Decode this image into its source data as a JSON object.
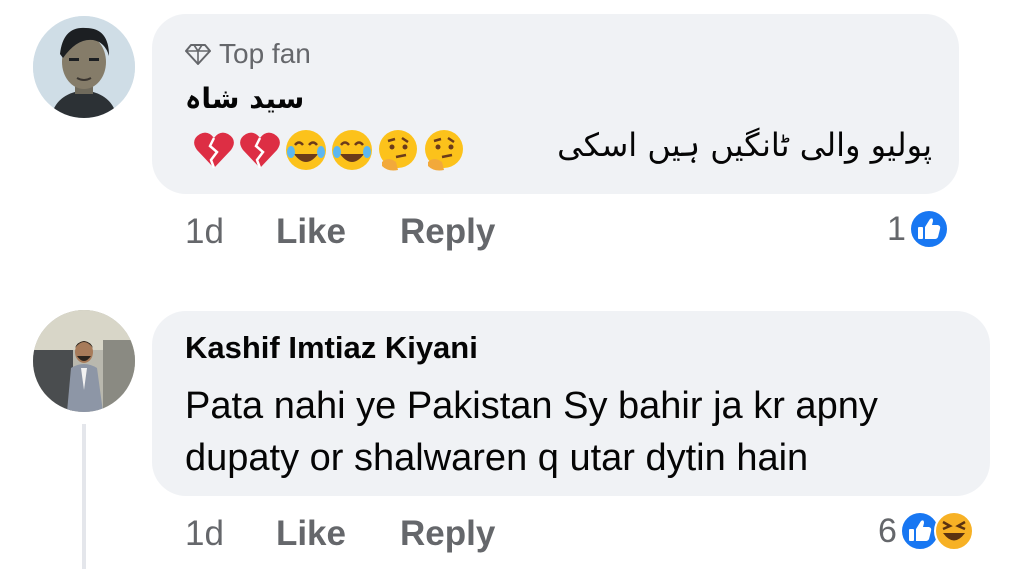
{
  "comments": [
    {
      "author": "سید شاہ",
      "badge": "Top fan",
      "text": "پولیو والی ٹانگیں ہیں اسکی",
      "emojis": [
        "broken-heart",
        "broken-heart",
        "tears-of-joy",
        "tears-of-joy",
        "thinking",
        "thinking"
      ],
      "time": "1d",
      "like_label": "Like",
      "reply_label": "Reply",
      "reaction_count": "1",
      "reactions": [
        "like-reaction-icon"
      ]
    },
    {
      "author": "Kashif Imtiaz Kiyani",
      "text": "Pata nahi ye Pakistan Sy bahir ja kr apny dupaty or shalwaren q utar dytin hain",
      "time": "1d",
      "like_label": "Like",
      "reply_label": "Reply",
      "reaction_count": "6",
      "reactions": [
        "like-reaction-icon",
        "haha-reaction-icon"
      ]
    }
  ],
  "colors": {
    "bubble": "#f0f2f5",
    "like_blue": "#1877f2",
    "meta_gray": "#65676b"
  }
}
